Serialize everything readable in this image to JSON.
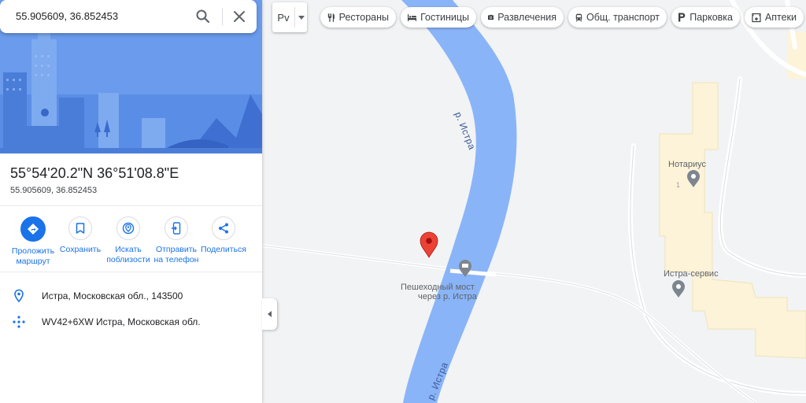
{
  "search": {
    "value": "55.905609, 36.852453",
    "search_icon": "search-icon",
    "close_icon": "close-icon"
  },
  "place": {
    "title": "55°54'20.2\"N 36°51'08.8\"E",
    "subtitle": "55.905609, 36.852453"
  },
  "actions": [
    {
      "label_line1": "Проложить",
      "label_line2": "маршрут",
      "icon": "directions-icon"
    },
    {
      "label_line1": "Сохранить",
      "label_line2": "",
      "icon": "bookmark-icon"
    },
    {
      "label_line1": "Искать",
      "label_line2": "поблизости",
      "icon": "nearby-icon"
    },
    {
      "label_line1": "Отправить",
      "label_line2": "на телефон",
      "icon": "send-to-phone-icon"
    },
    {
      "label_line1": "Поделиться",
      "label_line2": "",
      "icon": "share-icon"
    }
  ],
  "info": {
    "address": "Истра, Московская обл., 143500",
    "plus_code": "WV42+6XW Истра, Московская обл."
  },
  "layers": {
    "label": "Рv"
  },
  "chips": [
    {
      "label": "Рестораны",
      "icon": "restaurant-icon"
    },
    {
      "label": "Гостиницы",
      "icon": "hotel-icon"
    },
    {
      "label": "Развлечения",
      "icon": "camera-icon"
    },
    {
      "label": "Общ. транспорт",
      "icon": "transit-icon"
    },
    {
      "label": "Парковка",
      "icon": "parking-icon"
    },
    {
      "label": "Аптеки",
      "icon": "pharmacy-icon"
    }
  ],
  "map": {
    "river_label_1": "р. Истра",
    "river_label_2": "р. Истра",
    "bridge_line1": "Пешеходный мост",
    "bridge_line2": "через р. Истра",
    "poi_notary": "Нотариус",
    "poi_service": "Истра-сервис",
    "building_number": "1"
  },
  "colors": {
    "river": "#8ab4f8",
    "accent": "#1a73e8",
    "pin": "#ea4335",
    "building": "#fdf3d8"
  }
}
